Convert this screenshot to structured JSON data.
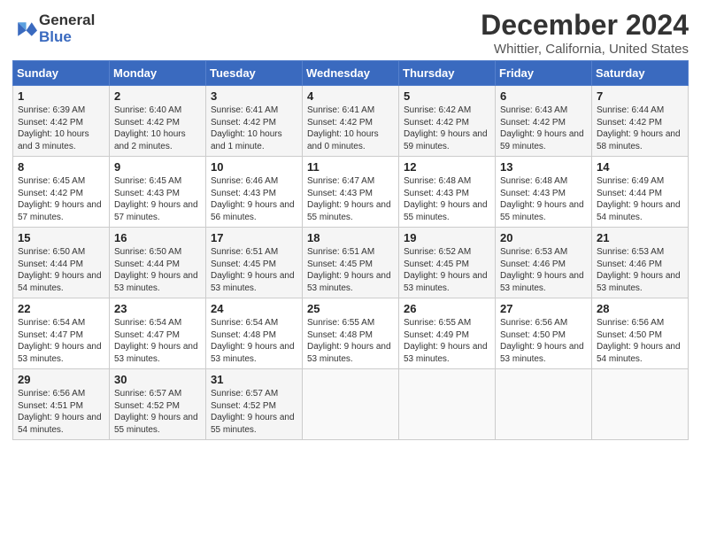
{
  "header": {
    "logo_line1": "General",
    "logo_line2": "Blue",
    "title": "December 2024",
    "subtitle": "Whittier, California, United States"
  },
  "days_of_week": [
    "Sunday",
    "Monday",
    "Tuesday",
    "Wednesday",
    "Thursday",
    "Friday",
    "Saturday"
  ],
  "weeks": [
    [
      {
        "day": "1",
        "sunrise": "Sunrise: 6:39 AM",
        "sunset": "Sunset: 4:42 PM",
        "daylight": "Daylight: 10 hours and 3 minutes."
      },
      {
        "day": "2",
        "sunrise": "Sunrise: 6:40 AM",
        "sunset": "Sunset: 4:42 PM",
        "daylight": "Daylight: 10 hours and 2 minutes."
      },
      {
        "day": "3",
        "sunrise": "Sunrise: 6:41 AM",
        "sunset": "Sunset: 4:42 PM",
        "daylight": "Daylight: 10 hours and 1 minute."
      },
      {
        "day": "4",
        "sunrise": "Sunrise: 6:41 AM",
        "sunset": "Sunset: 4:42 PM",
        "daylight": "Daylight: 10 hours and 0 minutes."
      },
      {
        "day": "5",
        "sunrise": "Sunrise: 6:42 AM",
        "sunset": "Sunset: 4:42 PM",
        "daylight": "Daylight: 9 hours and 59 minutes."
      },
      {
        "day": "6",
        "sunrise": "Sunrise: 6:43 AM",
        "sunset": "Sunset: 4:42 PM",
        "daylight": "Daylight: 9 hours and 59 minutes."
      },
      {
        "day": "7",
        "sunrise": "Sunrise: 6:44 AM",
        "sunset": "Sunset: 4:42 PM",
        "daylight": "Daylight: 9 hours and 58 minutes."
      }
    ],
    [
      {
        "day": "8",
        "sunrise": "Sunrise: 6:45 AM",
        "sunset": "Sunset: 4:42 PM",
        "daylight": "Daylight: 9 hours and 57 minutes."
      },
      {
        "day": "9",
        "sunrise": "Sunrise: 6:45 AM",
        "sunset": "Sunset: 4:43 PM",
        "daylight": "Daylight: 9 hours and 57 minutes."
      },
      {
        "day": "10",
        "sunrise": "Sunrise: 6:46 AM",
        "sunset": "Sunset: 4:43 PM",
        "daylight": "Daylight: 9 hours and 56 minutes."
      },
      {
        "day": "11",
        "sunrise": "Sunrise: 6:47 AM",
        "sunset": "Sunset: 4:43 PM",
        "daylight": "Daylight: 9 hours and 55 minutes."
      },
      {
        "day": "12",
        "sunrise": "Sunrise: 6:48 AM",
        "sunset": "Sunset: 4:43 PM",
        "daylight": "Daylight: 9 hours and 55 minutes."
      },
      {
        "day": "13",
        "sunrise": "Sunrise: 6:48 AM",
        "sunset": "Sunset: 4:43 PM",
        "daylight": "Daylight: 9 hours and 55 minutes."
      },
      {
        "day": "14",
        "sunrise": "Sunrise: 6:49 AM",
        "sunset": "Sunset: 4:44 PM",
        "daylight": "Daylight: 9 hours and 54 minutes."
      }
    ],
    [
      {
        "day": "15",
        "sunrise": "Sunrise: 6:50 AM",
        "sunset": "Sunset: 4:44 PM",
        "daylight": "Daylight: 9 hours and 54 minutes."
      },
      {
        "day": "16",
        "sunrise": "Sunrise: 6:50 AM",
        "sunset": "Sunset: 4:44 PM",
        "daylight": "Daylight: 9 hours and 53 minutes."
      },
      {
        "day": "17",
        "sunrise": "Sunrise: 6:51 AM",
        "sunset": "Sunset: 4:45 PM",
        "daylight": "Daylight: 9 hours and 53 minutes."
      },
      {
        "day": "18",
        "sunrise": "Sunrise: 6:51 AM",
        "sunset": "Sunset: 4:45 PM",
        "daylight": "Daylight: 9 hours and 53 minutes."
      },
      {
        "day": "19",
        "sunrise": "Sunrise: 6:52 AM",
        "sunset": "Sunset: 4:45 PM",
        "daylight": "Daylight: 9 hours and 53 minutes."
      },
      {
        "day": "20",
        "sunrise": "Sunrise: 6:53 AM",
        "sunset": "Sunset: 4:46 PM",
        "daylight": "Daylight: 9 hours and 53 minutes."
      },
      {
        "day": "21",
        "sunrise": "Sunrise: 6:53 AM",
        "sunset": "Sunset: 4:46 PM",
        "daylight": "Daylight: 9 hours and 53 minutes."
      }
    ],
    [
      {
        "day": "22",
        "sunrise": "Sunrise: 6:54 AM",
        "sunset": "Sunset: 4:47 PM",
        "daylight": "Daylight: 9 hours and 53 minutes."
      },
      {
        "day": "23",
        "sunrise": "Sunrise: 6:54 AM",
        "sunset": "Sunset: 4:47 PM",
        "daylight": "Daylight: 9 hours and 53 minutes."
      },
      {
        "day": "24",
        "sunrise": "Sunrise: 6:54 AM",
        "sunset": "Sunset: 4:48 PM",
        "daylight": "Daylight: 9 hours and 53 minutes."
      },
      {
        "day": "25",
        "sunrise": "Sunrise: 6:55 AM",
        "sunset": "Sunset: 4:48 PM",
        "daylight": "Daylight: 9 hours and 53 minutes."
      },
      {
        "day": "26",
        "sunrise": "Sunrise: 6:55 AM",
        "sunset": "Sunset: 4:49 PM",
        "daylight": "Daylight: 9 hours and 53 minutes."
      },
      {
        "day": "27",
        "sunrise": "Sunrise: 6:56 AM",
        "sunset": "Sunset: 4:50 PM",
        "daylight": "Daylight: 9 hours and 53 minutes."
      },
      {
        "day": "28",
        "sunrise": "Sunrise: 6:56 AM",
        "sunset": "Sunset: 4:50 PM",
        "daylight": "Daylight: 9 hours and 54 minutes."
      }
    ],
    [
      {
        "day": "29",
        "sunrise": "Sunrise: 6:56 AM",
        "sunset": "Sunset: 4:51 PM",
        "daylight": "Daylight: 9 hours and 54 minutes."
      },
      {
        "day": "30",
        "sunrise": "Sunrise: 6:57 AM",
        "sunset": "Sunset: 4:52 PM",
        "daylight": "Daylight: 9 hours and 55 minutes."
      },
      {
        "day": "31",
        "sunrise": "Sunrise: 6:57 AM",
        "sunset": "Sunset: 4:52 PM",
        "daylight": "Daylight: 9 hours and 55 minutes."
      },
      null,
      null,
      null,
      null
    ]
  ]
}
